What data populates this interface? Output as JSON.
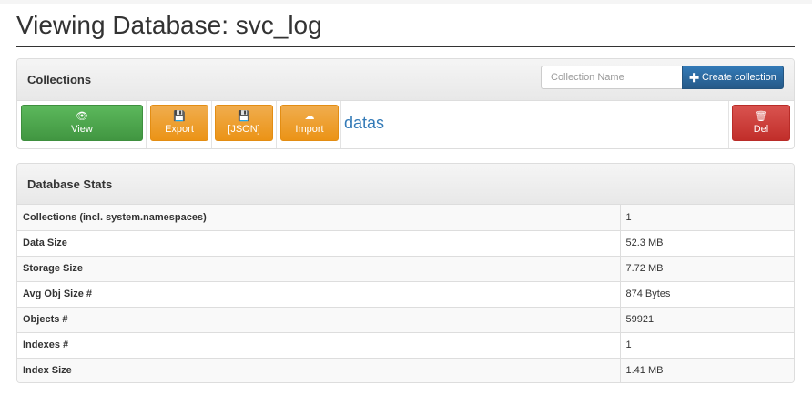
{
  "page": {
    "title": "Viewing Database: svc_log"
  },
  "collections": {
    "heading": "Collections",
    "input_placeholder": "Collection Name",
    "create_button": "Create collection",
    "items": [
      {
        "name": "datas",
        "view_label": "View",
        "export_label": "Export",
        "json_label": "[JSON]",
        "import_label": "Import",
        "delete_label": "Del"
      }
    ]
  },
  "stats": {
    "heading": "Database Stats",
    "rows": [
      {
        "label": "Collections (incl. system.namespaces)",
        "value": "1"
      },
      {
        "label": "Data Size",
        "value": "52.3 MB"
      },
      {
        "label": "Storage Size",
        "value": "7.72 MB"
      },
      {
        "label": "Avg Obj Size #",
        "value": "874 Bytes"
      },
      {
        "label": "Objects #",
        "value": "59921"
      },
      {
        "label": "Indexes #",
        "value": "1"
      },
      {
        "label": "Index Size",
        "value": "1.41 MB"
      }
    ]
  },
  "icons": {
    "view": "eye-icon",
    "export": "floppy-icon",
    "json": "floppy-icon",
    "import": "cloud-upload-icon",
    "delete": "trash-icon",
    "create": "plus-icon"
  },
  "colors": {
    "primary": "#337ab7",
    "success": "#5cb85c",
    "warning": "#f0ad4e",
    "danger": "#d9534f",
    "title_rule": "#333333"
  }
}
